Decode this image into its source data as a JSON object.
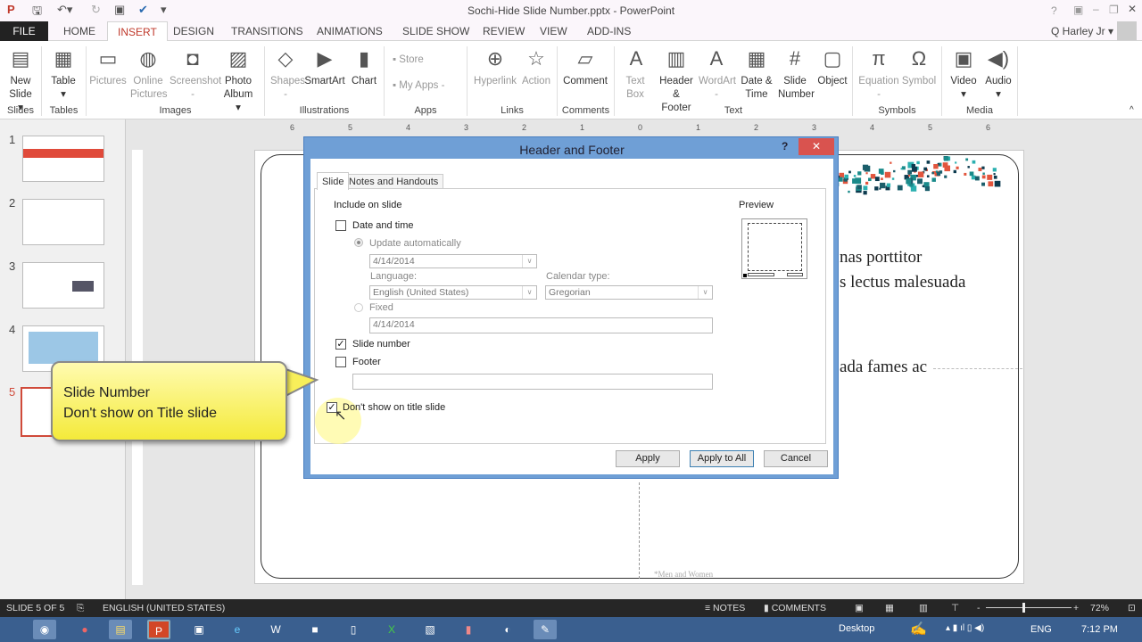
{
  "window": {
    "title": "Sochi-Hide Slide Number.pptx - PowerPoint",
    "user": "Q Harley Jr",
    "help": "?"
  },
  "tabs": [
    "FILE",
    "HOME",
    "INSERT",
    "DESIGN",
    "TRANSITIONS",
    "ANIMATIONS",
    "SLIDE SHOW",
    "REVIEW",
    "VIEW",
    "ADD-INS"
  ],
  "ribbon": {
    "buttons": [
      {
        "l1": "New",
        "l2": "Slide ▾",
        "icon": "new-slide-icon",
        "g": "▤",
        "dis": false
      },
      {
        "l1": "Table",
        "l2": "▾",
        "icon": "table-icon",
        "g": "▦",
        "dis": false
      },
      {
        "l1": "Pictures",
        "l2": "",
        "icon": "pictures-icon",
        "g": "▭",
        "dis": true
      },
      {
        "l1": "Online",
        "l2": "Pictures",
        "icon": "online-pictures-icon",
        "g": "◍",
        "dis": true
      },
      {
        "l1": "Screenshot",
        "l2": "-",
        "icon": "screenshot-icon",
        "g": "◘",
        "dis": true
      },
      {
        "l1": "Photo",
        "l2": "Album ▾",
        "icon": "photo-album-icon",
        "g": "▨",
        "dis": false
      },
      {
        "l1": "Shapes",
        "l2": "-",
        "icon": "shapes-icon",
        "g": "◇",
        "dis": true
      },
      {
        "l1": "SmartArt",
        "l2": "",
        "icon": "smartart-icon",
        "g": "▶",
        "dis": false
      },
      {
        "l1": "Chart",
        "l2": "",
        "icon": "chart-icon",
        "g": "▮",
        "dis": false
      },
      {
        "l1": "Hyperlink",
        "l2": "",
        "icon": "hyperlink-icon",
        "g": "⊕",
        "dis": true
      },
      {
        "l1": "Action",
        "l2": "",
        "icon": "action-icon",
        "g": "☆",
        "dis": true
      },
      {
        "l1": "Comment",
        "l2": "",
        "icon": "comment-icon",
        "g": "▱",
        "dis": false
      },
      {
        "l1": "Text",
        "l2": "Box",
        "icon": "text-box-icon",
        "g": "A",
        "dis": true
      },
      {
        "l1": "Header",
        "l2": "& Footer",
        "icon": "header-footer-icon",
        "g": "▥",
        "dis": false
      },
      {
        "l1": "WordArt",
        "l2": "-",
        "icon": "wordart-icon",
        "g": "A",
        "dis": true
      },
      {
        "l1": "Date &",
        "l2": "Time",
        "icon": "date-time-icon",
        "g": "▦",
        "dis": false
      },
      {
        "l1": "Slide",
        "l2": "Number",
        "icon": "slide-number-icon",
        "g": "#",
        "dis": false
      },
      {
        "l1": "Object",
        "l2": "",
        "icon": "object-icon",
        "g": "▢",
        "dis": false
      },
      {
        "l1": "Equation",
        "l2": "-",
        "icon": "equation-icon",
        "g": "π",
        "dis": true
      },
      {
        "l1": "Symbol",
        "l2": "",
        "icon": "symbol-icon",
        "g": "Ω",
        "dis": true
      },
      {
        "l1": "Video",
        "l2": "▾",
        "icon": "video-icon",
        "g": "▣",
        "dis": false
      },
      {
        "l1": "Audio",
        "l2": "▾",
        "icon": "audio-icon",
        "g": "◀)",
        "dis": false
      }
    ],
    "store": "Store",
    "my_apps": "My Apps",
    "groups": [
      "Slides",
      "Tables",
      "Images",
      "Illustrations",
      "Apps",
      "Links",
      "Comments",
      "Text",
      "Symbols",
      "Media"
    ]
  },
  "thumbnails": [
    "1",
    "2",
    "3",
    "4",
    "5"
  ],
  "ruler": [
    "6",
    "5",
    "4",
    "3",
    "2",
    "1",
    "0",
    "1",
    "2",
    "3",
    "4",
    "5",
    "6"
  ],
  "slide": {
    "lines": [
      "nas porttitor",
      "s lectus malesuada",
      "ada fames ac"
    ],
    "footer": "*Men and Women"
  },
  "dialog": {
    "title": "Header and Footer",
    "tabs": [
      "Slide",
      "Notes and Handouts"
    ],
    "include_label": "Include on slide",
    "preview_label": "Preview",
    "date_time": {
      "label": "Date and time",
      "checked": false
    },
    "update_auto": "Update automatically",
    "auto_value": "4/14/2014",
    "language_label": "Language:",
    "language_value": "English (United States)",
    "calendar_label": "Calendar type:",
    "calendar_value": "Gregorian",
    "fixed": "Fixed",
    "fixed_value": "4/14/2014",
    "slide_number": {
      "label": "Slide number",
      "checked": true
    },
    "footer": {
      "label": "Footer",
      "checked": false,
      "value": ""
    },
    "dont_show": {
      "label": "Don't show on title slide",
      "checked": true
    },
    "apply": "Apply",
    "apply_all": "Apply to All",
    "cancel": "Cancel"
  },
  "callout": {
    "line1": "Slide Number",
    "line2": "Don't show on Title slide"
  },
  "status": {
    "slide": "SLIDE 5 OF 5",
    "language": "ENGLISH (UNITED STATES)",
    "notes": "NOTES",
    "comments": "COMMENTS",
    "zoom": "72%",
    "zoom_percent": 72
  },
  "taskbar": {
    "desktop": "Desktop",
    "lang": "ENG",
    "time": "7:12 PM"
  }
}
